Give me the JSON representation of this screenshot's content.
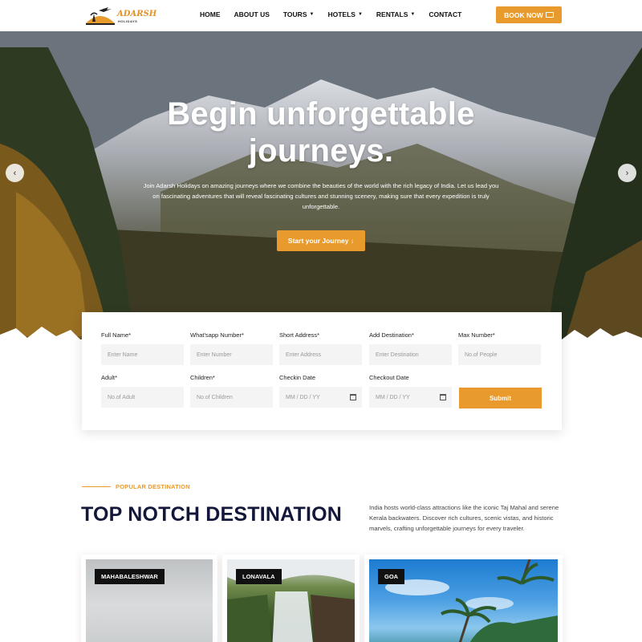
{
  "brand": {
    "name": "ADARSH",
    "subtitle": "HOLIDAYS",
    "accent": "#e89a2c",
    "navy": "#13183a"
  },
  "nav": {
    "items": [
      {
        "label": "HOME",
        "dropdown": false
      },
      {
        "label": "ABOUT US",
        "dropdown": false
      },
      {
        "label": "TOURS",
        "dropdown": true
      },
      {
        "label": "HOTELS",
        "dropdown": true
      },
      {
        "label": "RENTALS",
        "dropdown": true
      },
      {
        "label": "CONTACT",
        "dropdown": false
      }
    ],
    "book_label": "BOOK NOW"
  },
  "hero": {
    "title_line1": "Begin unforgettable",
    "title_line2": "journeys.",
    "description": "Join Adarsh Holidays on amazing journeys where we combine the beauties of the world with the rich legacy of India. Let us lead you on fascinating adventures that will reveal fascinating cultures and stunning scenery, making sure that every expedition is truly unforgettable.",
    "cta_label": "Start your Journey ↓",
    "prev_icon": "‹",
    "next_icon": "›"
  },
  "form": {
    "fields": [
      {
        "label": "Full Name*",
        "placeholder": "Enter Name"
      },
      {
        "label": "What'sapp Number*",
        "placeholder": "Enter Number"
      },
      {
        "label": "Short Address*",
        "placeholder": "Enter Address"
      },
      {
        "label": "Add Destination*",
        "placeholder": "Enter Destination"
      },
      {
        "label": "Max Number*",
        "placeholder": "No.of People"
      },
      {
        "label": "Adult*",
        "placeholder": "No.of Adult"
      },
      {
        "label": "Children*",
        "placeholder": "No.of Children"
      },
      {
        "label": "Checkin Date",
        "placeholder": "MM / DD / YY"
      },
      {
        "label": "Checkout Date",
        "placeholder": "MM / DD / YY"
      }
    ],
    "submit_label": "Submit"
  },
  "destinations": {
    "eyebrow": "POPULAR DESTINATION",
    "title": "TOP NOTCH DESTINATION",
    "description": "India hosts world-class attractions like the iconic Taj Mahal and serene Kerala backwaters. Discover rich cultures, scenic vistas, and historic marvels, crafting unforgettable journeys for every traveler.",
    "cards": [
      {
        "name": "MAHABALESHWAR"
      },
      {
        "name": "LONAVALA"
      },
      {
        "name": "GOA"
      }
    ]
  }
}
